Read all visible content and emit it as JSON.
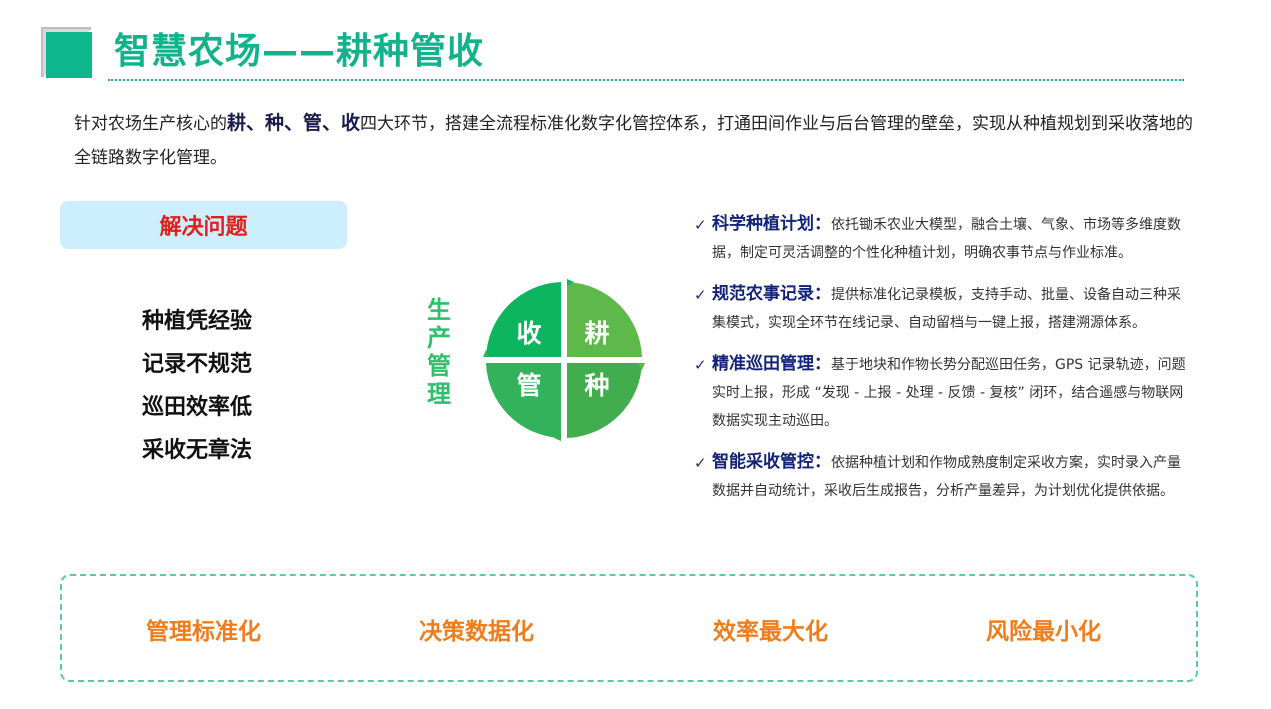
{
  "header": {
    "title": "智慧农场——耕种管收"
  },
  "intro": {
    "prefix": "针对农场生产核心的",
    "emphasis": "耕、种、管、收",
    "suffix": "四大环节，搭建全流程标准化数字化管控体系，打通田间作业与后台管理的壁垒，实现从种植规划到采收落地的全链路数字化管理。"
  },
  "problems": {
    "heading": "解决问题",
    "items": [
      "种植凭经验",
      "记录不规范",
      "巡田效率低",
      "采收无章法"
    ]
  },
  "diagram": {
    "vertical_label": "生产管理",
    "quadrants": {
      "top_left": "收",
      "top_right": "耕",
      "bottom_left": "管",
      "bottom_right": "种"
    },
    "colors": {
      "top_left": "#0eb55f",
      "top_right": "#5fb84a",
      "bottom_left": "#33b25c",
      "bottom_right": "#41ad4d"
    }
  },
  "features": [
    {
      "title": "科学种植计划：",
      "text": "依托锄禾农业大模型，融合土壤、气象、市场等多维度数据，制定可灵活调整的个性化种植计划，明确农事节点与作业标准。"
    },
    {
      "title": "规范农事记录：",
      "text": "提供标准化记录模板，支持手动、批量、设备自动三种采集模式，实现全环节在线记录、自动留档与一键上报，搭建溯源体系。"
    },
    {
      "title": "精准巡田管理：",
      "text": "基于地块和作物长势分配巡田任务，GPS 记录轨迹，问题实时上报，形成 “发现 - 上报 - 处理 - 反馈 - 复核” 闭环，结合遥感与物联网数据实现主动巡田。"
    },
    {
      "title": "智能采收管控：",
      "text": "依据种植计划和作物成熟度制定采收方案，实时录入产量数据并自动统计，采收后生成报告，分析产量差异，为计划优化提供依据。"
    }
  ],
  "outcomes": [
    "管理标准化",
    "决策数据化",
    "效率最大化",
    "风险最小化"
  ],
  "colors": {
    "accent": "#10b38b",
    "problem": "#e0201b",
    "outcome": "#f07d1c",
    "feature_title": "#13237a"
  }
}
